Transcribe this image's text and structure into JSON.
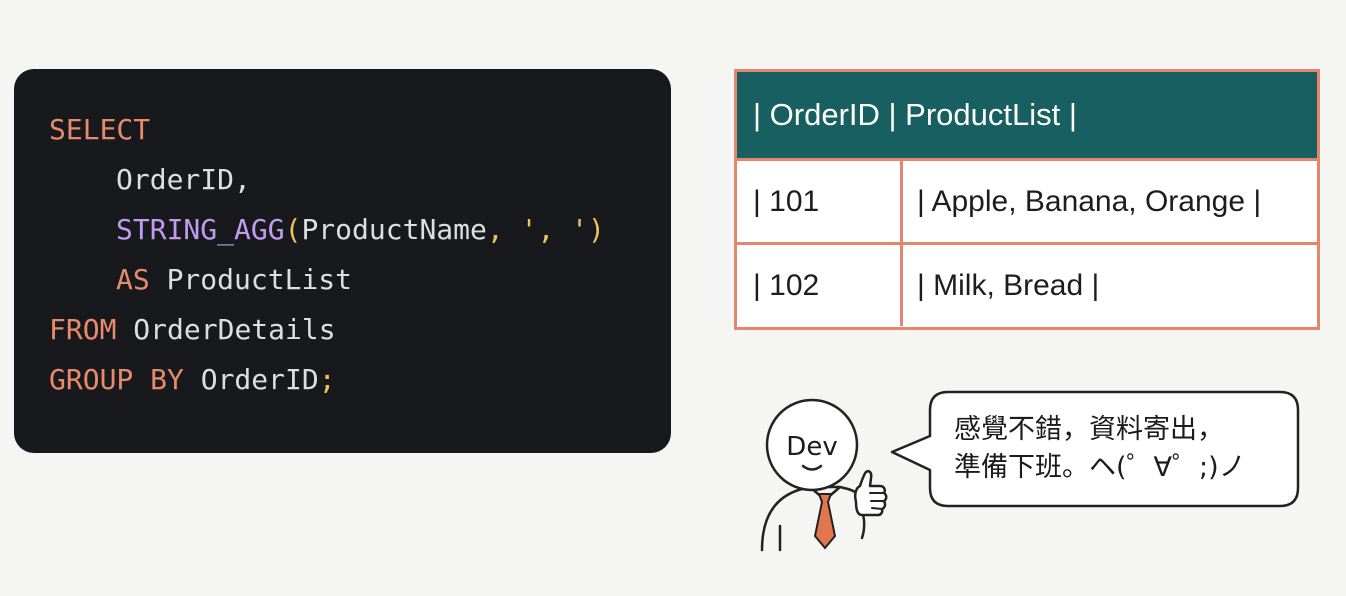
{
  "sql": {
    "select_kw": "SELECT",
    "col_orderid": "OrderID,",
    "fn_name": "STRING_AGG",
    "paren_open": "(",
    "fn_arg": "ProductName",
    "comma": ",",
    "sep_literal": "', '",
    "paren_close": ")",
    "as_kw": "AS",
    "alias": "ProductList",
    "from_kw": "FROM",
    "table_name": "OrderDetails",
    "groupby_kw": "GROUP BY",
    "group_col": "OrderID",
    "semicolon": ";"
  },
  "table": {
    "header": "| OrderID | ProductList |",
    "rows": [
      {
        "id": "| 101",
        "list": "| Apple, Banana, Orange |"
      },
      {
        "id": "| 102",
        "list": "| Milk, Bread |"
      }
    ]
  },
  "character": {
    "label": "Dev"
  },
  "speech": {
    "line1": "感覺不錯，資料寄出，",
    "line2": "準備下班。ヘ(゜∀゜;)ノ"
  },
  "colors": {
    "code_background": "#17191d",
    "keyword": "#e98a6c",
    "function": "#c09cf0",
    "punctuation": "#ecc35a",
    "table_header": "#185f62",
    "table_border": "#e3866b",
    "tie": "#e2764f"
  },
  "icons": {
    "character": "developer-thumbs-up-figure",
    "bubble": "speech-bubble"
  }
}
